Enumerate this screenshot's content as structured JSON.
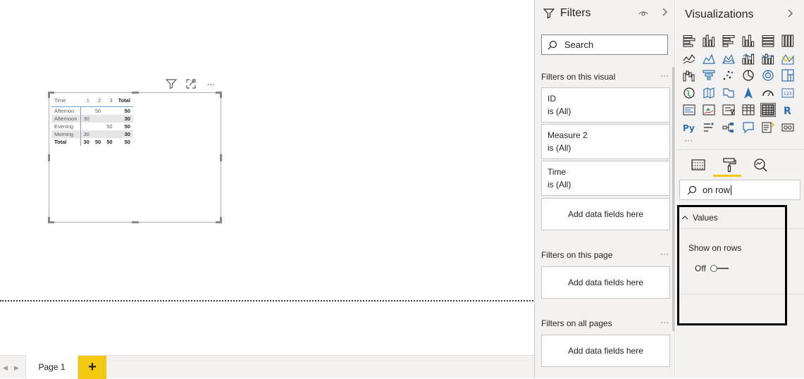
{
  "visual": {
    "header_icons": [
      "filter-icon",
      "focus-mode-icon",
      "more-options-icon"
    ],
    "more_glyph": "···",
    "matrix": {
      "columns": [
        "Time",
        "1",
        "2",
        "3",
        "Total"
      ],
      "rows": [
        {
          "label": "Afternon",
          "c1": "",
          "c2": "50",
          "c3": "",
          "total": "50"
        },
        {
          "label": "Afternoon",
          "c1": "30",
          "c2": "",
          "c3": "",
          "total": "30"
        },
        {
          "label": "Evening",
          "c1": "",
          "c2": "",
          "c3": "50",
          "total": "50"
        },
        {
          "label": "Morning",
          "c1": "30",
          "c2": "",
          "c3": "",
          "total": "30"
        }
      ],
      "total_row": {
        "label": "Total",
        "c1": "30",
        "c2": "50",
        "c3": "50",
        "total": "50"
      }
    }
  },
  "bottom": {
    "page_tab": "Page 1",
    "add_page": "+"
  },
  "filters": {
    "title": "Filters",
    "search_placeholder": "Search",
    "section_visual": "Filters on this visual",
    "section_page": "Filters on this page",
    "section_all": "Filters on all pages",
    "dots": "···",
    "cards": [
      {
        "name": "ID",
        "state": "is (All)"
      },
      {
        "name": "Measure 2",
        "state": "is (All)"
      },
      {
        "name": "Time",
        "state": "is (All)"
      }
    ],
    "add_label": "Add data fields here"
  },
  "visualizations": {
    "title": "Visualizations",
    "more": "···",
    "icons": [
      "stacked-bar-icon",
      "stacked-column-icon",
      "clustered-bar-icon",
      "clustered-column-icon",
      "100-bar-icon",
      "100-column-icon",
      "line-chart-icon",
      "area-chart-icon",
      "stacked-area-icon",
      "line-column-icon",
      "line-clustered-column-icon",
      "ribbon-chart-icon",
      "waterfall-icon",
      "funnel-icon",
      "scatter-icon",
      "pie-chart-icon",
      "donut-chart-icon",
      "treemap-icon",
      "map-icon",
      "filled-map-icon",
      "shape-map-icon",
      "azure-map-icon",
      "gauge-icon",
      "card-icon",
      "multi-row-card-icon",
      "kpi-icon",
      "slicer-icon",
      "table-icon",
      "matrix-icon",
      "r-visual-icon",
      "python-visual-icon",
      "key-influencers-icon",
      "decomposition-tree-icon",
      "qa-icon",
      "smart-narrative-icon",
      "paginated-report-icon"
    ],
    "search_value": "on row",
    "section": "Values",
    "setting_label": "Show on rows",
    "toggle_state": "Off",
    "accent": "#f2c811"
  }
}
